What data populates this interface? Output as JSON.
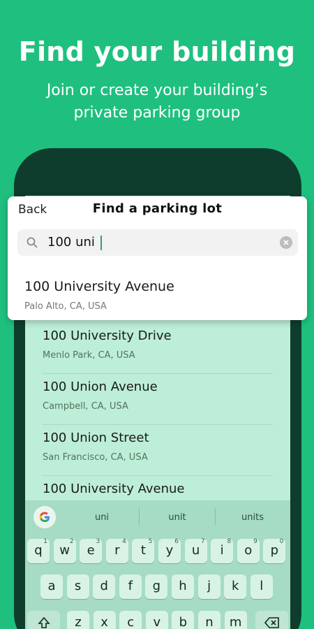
{
  "hero": {
    "title": "Find your building",
    "subtitle": "Join or create your building’s private parking group"
  },
  "card": {
    "back_label": "Back",
    "title": "Find a parking lot",
    "search_value": "100 uni",
    "top_result": {
      "name": "100 University Avenue",
      "address": "Palo Alto, CA, USA"
    }
  },
  "results": [
    {
      "name": "100 University Drive",
      "address": "Menlo Park, CA, USA"
    },
    {
      "name": "100 Union Avenue",
      "address": "Campbell, CA, USA"
    },
    {
      "name": "100 Union Street",
      "address": "San Francisco, CA, USA"
    },
    {
      "name": "100 University Avenue",
      "address": ""
    }
  ],
  "keyboard": {
    "suggestions": [
      "uni",
      "unit",
      "units"
    ],
    "row1": [
      "q",
      "w",
      "e",
      "r",
      "t",
      "y",
      "u",
      "i",
      "o",
      "p"
    ],
    "row1_hints": [
      "1",
      "2",
      "3",
      "4",
      "5",
      "6",
      "7",
      "8",
      "9",
      "0"
    ],
    "row2": [
      "a",
      "s",
      "d",
      "f",
      "g",
      "h",
      "j",
      "k",
      "l"
    ],
    "row3": [
      "z",
      "x",
      "c",
      "v",
      "b",
      "n",
      "m"
    ]
  },
  "colors": {
    "background": "#1fc07f",
    "phone": "#0e3d2e",
    "screen": "#bdeed8",
    "keyboard": "#a6dcc4"
  }
}
